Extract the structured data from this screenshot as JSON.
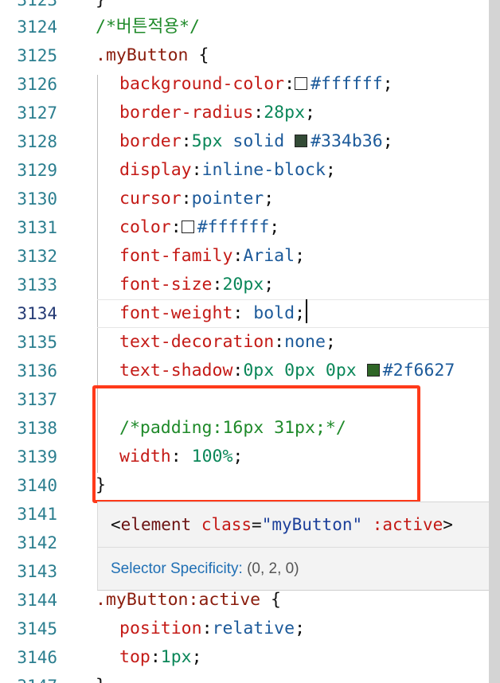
{
  "lines": [
    {
      "ln": "3124",
      "text": "/*버튼적용*/"
    },
    {
      "ln": "3125",
      "selector": ".myButton",
      "brace": " {"
    },
    {
      "ln": "3126",
      "prop": "background-color",
      "value": "#ffffff",
      "swatch": "#ffffff"
    },
    {
      "ln": "3127",
      "prop": "border-radius",
      "value": "28px"
    },
    {
      "ln": "3128",
      "prop": "border",
      "value_a": "5px",
      "value_b": " solid ",
      "value_c": "#334b36",
      "swatch": "#334b36"
    },
    {
      "ln": "3129",
      "prop": "display",
      "value": "inline-block"
    },
    {
      "ln": "3130",
      "prop": "cursor",
      "value": "pointer"
    },
    {
      "ln": "3131",
      "prop": "color",
      "value": "#ffffff",
      "swatch": "#ffffff"
    },
    {
      "ln": "3132",
      "prop": "font-family",
      "value": "Arial"
    },
    {
      "ln": "3133",
      "prop": "font-size",
      "value": "20px"
    },
    {
      "ln": "3134",
      "prop": "font-weight",
      "value": " bold"
    },
    {
      "ln": "3135",
      "prop": "text-decoration",
      "value": "none"
    },
    {
      "ln": "3136",
      "prop": "text-shadow",
      "value": "0px 0px 0px ",
      "value_c": "#2f6627",
      "swatch": "#2f6627"
    },
    {
      "ln": "3137"
    },
    {
      "ln": "3138",
      "text": "/*padding:16px 31px;*/"
    },
    {
      "ln": "3139",
      "prop": "width",
      "value": " 100%"
    },
    {
      "ln": "3140",
      "text": "}"
    },
    {
      "ln": "3141"
    },
    {
      "ln": "3142"
    },
    {
      "ln": "3143"
    },
    {
      "ln": "3144",
      "selector": ".myButton:active",
      "brace": " {"
    },
    {
      "ln": "3145",
      "prop": "position",
      "value": "relative"
    },
    {
      "ln": "3146",
      "prop": "top",
      "value": "1px"
    }
  ],
  "hover": {
    "open": "<",
    "tag": "element",
    "attr": " class",
    "eq": "=",
    "str": "\"myButton\"",
    "pseudo": " :active",
    "close": ">",
    "spec_label": "Selector Specificity:",
    "spec_value": " (0, 2, 0)"
  }
}
